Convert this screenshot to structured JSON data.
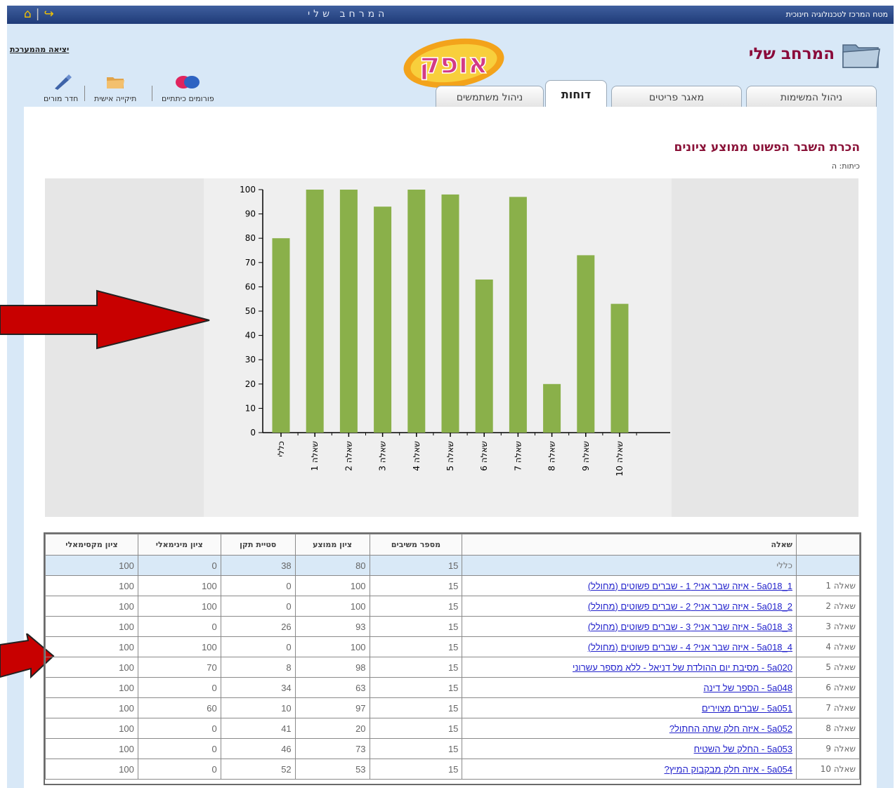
{
  "topbar": {
    "title": "המרחב שלי",
    "mta_label": "מטח המרכז לטכנולוגיה חינוכית"
  },
  "header": {
    "logo_text": "אופק",
    "exit_link": "יציאה מהמערכת",
    "my_space": "המרחב שלי",
    "tools": [
      {
        "label": "פורומים כיתתיים",
        "icon": "forum-bubbles-icon"
      },
      {
        "label": "תיקייה אישית",
        "icon": "personal-folder-icon"
      },
      {
        "label": "חדר מורים",
        "icon": "pen-icon"
      }
    ],
    "tabs": [
      {
        "label": "ניהול המשימות",
        "active": false
      },
      {
        "label": "מאגר פריטים",
        "active": false
      },
      {
        "label": "דוחות",
        "active": true
      },
      {
        "label": "ניהול משתמשים",
        "active": false
      }
    ]
  },
  "report": {
    "title": "הכרת השבר הפשוט ממוצע ציונים",
    "grade_line": "כיתות: ה"
  },
  "chart_data": {
    "type": "bar",
    "categories": [
      "כללי",
      "שאלה 1",
      "שאלה 2",
      "שאלה 3",
      "שאלה 4",
      "שאלה 5",
      "שאלה 6",
      "שאלה 7",
      "שאלה 8",
      "שאלה 9",
      "שאלה 10"
    ],
    "values": [
      80,
      100,
      100,
      93,
      100,
      98,
      63,
      97,
      20,
      73,
      53
    ],
    "yticks": [
      "0",
      "10",
      "20",
      "30",
      "40",
      "50",
      "60",
      "70",
      "80",
      "90",
      "100"
    ],
    "ylim": [
      0,
      100
    ],
    "bar_color": "#8ab04a",
    "grid": false
  },
  "table": {
    "headers": {
      "row_label": "",
      "question": "שאלה",
      "respondents": "מספר משיבים",
      "average": "ציון ממוצע",
      "std": "סטיית תקן",
      "min": "ציון מינימאלי",
      "max": "ציון מקסימאלי"
    },
    "rows": [
      {
        "label": "",
        "question": "כללי",
        "link": false,
        "respondents": "15",
        "average": "80",
        "std": "38",
        "min": "0",
        "max": "100"
      },
      {
        "label": "שאלה 1",
        "question": "5a018_1 - איזה שבר אני? 1 - שברים פשוטים (מחולל)",
        "link": true,
        "respondents": "15",
        "average": "100",
        "std": "0",
        "min": "100",
        "max": "100"
      },
      {
        "label": "שאלה 2",
        "question": "5a018_2 - איזה שבר אני? 2 - שברים פשוטים (מחולל)",
        "link": true,
        "respondents": "15",
        "average": "100",
        "std": "0",
        "min": "100",
        "max": "100"
      },
      {
        "label": "שאלה 3",
        "question": "5a018_3 - איזה שבר אני? 3 - שברים פשוטים (מחולל)",
        "link": true,
        "respondents": "15",
        "average": "93",
        "std": "26",
        "min": "0",
        "max": "100"
      },
      {
        "label": "שאלה 4",
        "question": "5a018_4 - איזה שבר אני? 4 - שברים פשוטים (מחולל)",
        "link": true,
        "respondents": "15",
        "average": "100",
        "std": "0",
        "min": "100",
        "max": "100"
      },
      {
        "label": "שאלה 5",
        "question": "5a020 - מסיבת יום ההולדת של דניאל - ללא מספר עשרוני",
        "link": true,
        "respondents": "15",
        "average": "98",
        "std": "8",
        "min": "70",
        "max": "100"
      },
      {
        "label": "שאלה 6",
        "question": "5a048 - הספר של דינה",
        "link": true,
        "respondents": "15",
        "average": "63",
        "std": "34",
        "min": "0",
        "max": "100"
      },
      {
        "label": "שאלה 7",
        "question": "5a051 - שברים מצוירים",
        "link": true,
        "respondents": "15",
        "average": "97",
        "std": "10",
        "min": "60",
        "max": "100"
      },
      {
        "label": "שאלה 8",
        "question": "5a052 - איזה חלק שתה החתול?",
        "link": true,
        "respondents": "15",
        "average": "20",
        "std": "41",
        "min": "0",
        "max": "100"
      },
      {
        "label": "שאלה 9",
        "question": "5a053 - החלק של השטיח",
        "link": true,
        "respondents": "15",
        "average": "73",
        "std": "46",
        "min": "0",
        "max": "100"
      },
      {
        "label": "שאלה 10",
        "question": "5a054 - איזה חלק מבקבוק המיץ?",
        "link": true,
        "respondents": "15",
        "average": "53",
        "std": "52",
        "min": "0",
        "max": "100"
      }
    ]
  },
  "colors": {
    "accent": "#8a1238",
    "header_bg": "#d8e8f7",
    "topbar": "#2a4684",
    "arrow": "#c80000",
    "link": "#2222cc"
  }
}
